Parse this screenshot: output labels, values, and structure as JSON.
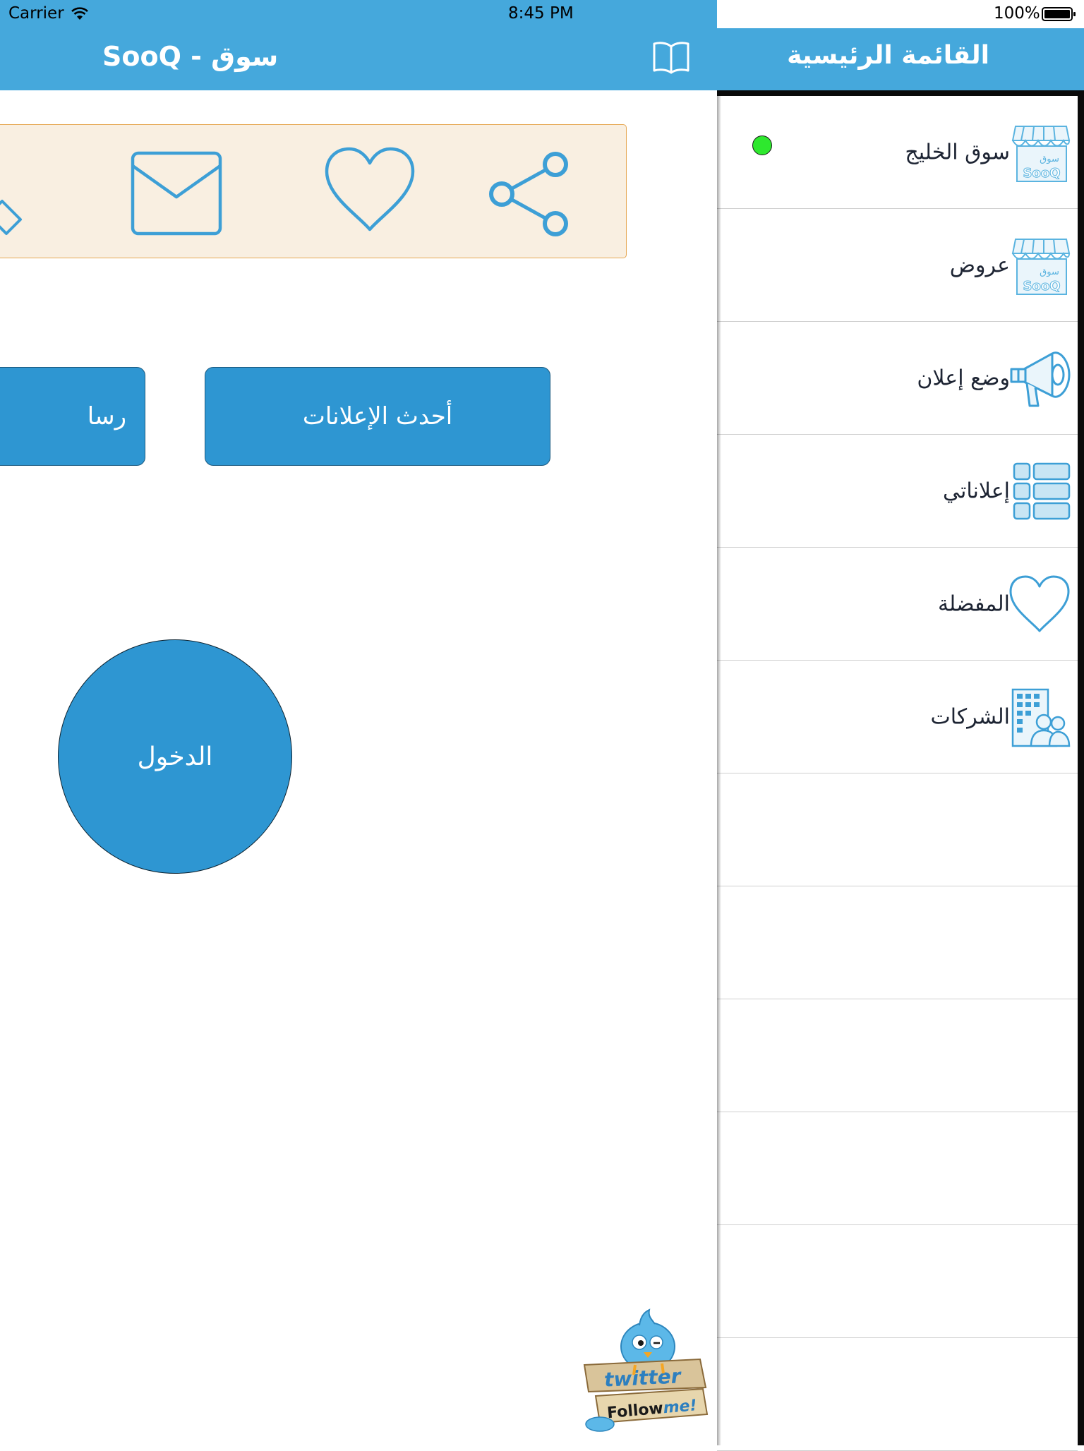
{
  "status_bar": {
    "carrier": "Carrier",
    "time": "8:45 PM",
    "battery": "100%"
  },
  "main": {
    "title": "SooQ - سوق",
    "buttons": {
      "latest_ads": "أحدث الإعلانات",
      "messages_partial": "رسا",
      "login": "الدخول"
    },
    "share_icons": [
      "share-icon",
      "heart-icon",
      "mail-icon",
      "diamond-icon"
    ],
    "twitter_badge": {
      "top": "twitter",
      "bottom_a": "Follow",
      "bottom_b": "me!"
    }
  },
  "side_menu": {
    "title": "القائمة الرئيسية",
    "items": [
      {
        "label": "سوق الخليج",
        "icon": "store-icon",
        "online": true
      },
      {
        "label": "عروض",
        "icon": "store-icon"
      },
      {
        "label": "وضع إعلان",
        "icon": "megaphone-icon"
      },
      {
        "label": "إعلاناتي",
        "icon": "list-icon"
      },
      {
        "label": "المفضلة",
        "icon": "heart-icon"
      },
      {
        "label": "الشركات",
        "icon": "building-icon"
      }
    ],
    "store_icon_text": {
      "arabic": "سوق",
      "latin": "SooQ"
    }
  },
  "colors": {
    "header": "#45a8dc",
    "button": "#2e96d2",
    "share_bar_bg": "#f9efe1",
    "share_bar_border": "#e6a752",
    "icon_blue": "#3d9fd6",
    "online": "#2ee82e"
  }
}
